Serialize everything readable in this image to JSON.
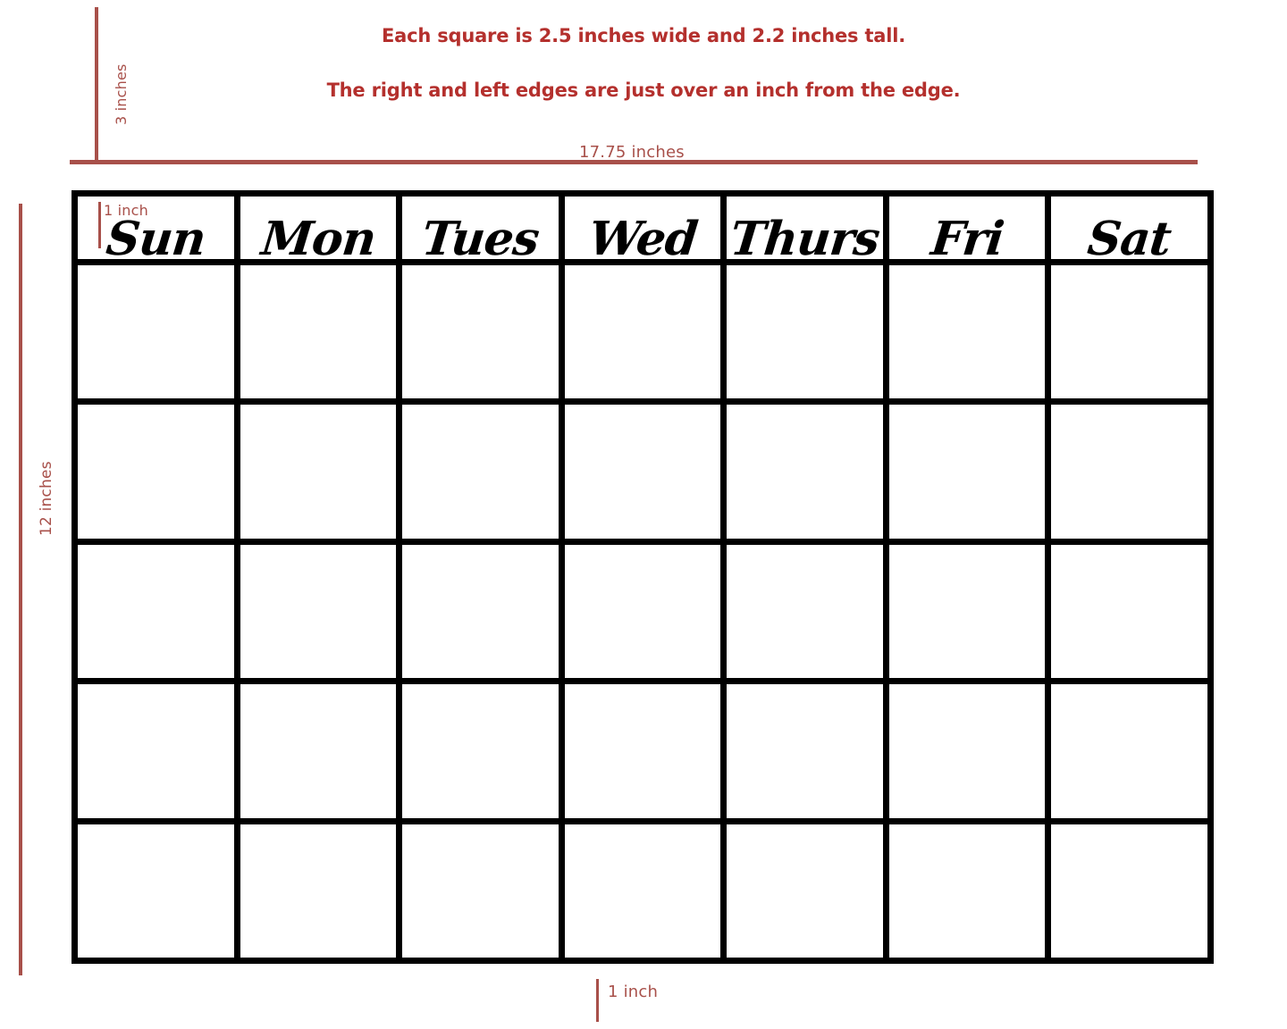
{
  "headlines": {
    "line1": "Each square is 2.5 inches wide and 2.2 inches tall.",
    "line2": "The right and left edges are just over an inch from the edge."
  },
  "measurements": {
    "top_vertical": "3 inches",
    "top_horizontal": "17.75 inches",
    "left_vertical": "12 inches",
    "inset_top": "1 inch",
    "inset_bottom": "1 inch"
  },
  "colors": {
    "headline_red": "#b4302d",
    "measure_red": "#a8504a",
    "grid_black": "#000000",
    "background": "#ffffff"
  },
  "calendar": {
    "day_headers": [
      "Sun",
      "Mon",
      "Tues",
      "Wed",
      "Thurs",
      "Fri",
      "Sat"
    ],
    "week_rows": 5,
    "columns": 7,
    "cells": [
      [
        "",
        "",
        "",
        "",
        "",
        "",
        ""
      ],
      [
        "",
        "",
        "",
        "",
        "",
        "",
        ""
      ],
      [
        "",
        "",
        "",
        "",
        "",
        "",
        ""
      ],
      [
        "",
        "",
        "",
        "",
        "",
        "",
        ""
      ],
      [
        "",
        "",
        "",
        "",
        "",
        "",
        ""
      ]
    ]
  }
}
